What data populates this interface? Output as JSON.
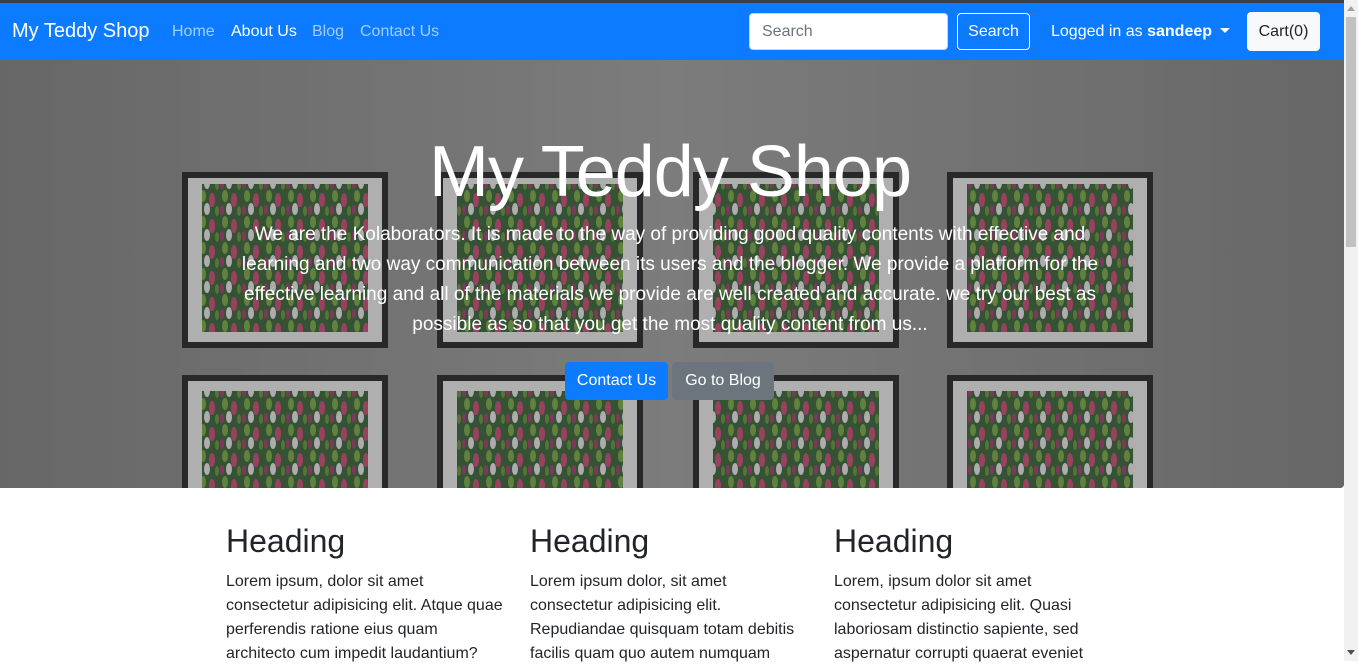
{
  "navbar": {
    "brand": "My Teddy Shop",
    "links": [
      {
        "label": "Home",
        "active": false
      },
      {
        "label": "About Us",
        "active": true
      },
      {
        "label": "Blog",
        "active": false
      },
      {
        "label": "Contact Us",
        "active": false
      }
    ],
    "search_placeholder": "Search",
    "search_button": "Search",
    "user_prefix": "Logged in as",
    "username": "sandeep",
    "cart_label": "Cart(0)"
  },
  "hero": {
    "title": "My Teddy Shop",
    "text": "We are the Kolaborators. It is made to the way of providing good quality contents with effective and learning and two way communication between its users and the blogger. We provide a platform for the effective learning and all of the materials we provide are well created and accurate. we try our best as possible as so that you get the most quality content from us...",
    "primary_button": "Contact Us",
    "secondary_button": "Go to Blog"
  },
  "columns": [
    {
      "heading": "Heading",
      "text": "Lorem ipsum, dolor sit amet consectetur adipisicing elit. Atque quae perferendis ratione eius quam architecto cum impedit laudantium?"
    },
    {
      "heading": "Heading",
      "text": "Lorem ipsum dolor, sit amet consectetur adipisicing elit. Repudiandae quisquam totam debitis facilis quam quo autem numquam"
    },
    {
      "heading": "Heading",
      "text": "Lorem, ipsum dolor sit amet consectetur adipisicing elit. Quasi laboriosam distinctio sapiente, sed aspernatur corrupti quaerat eveniet"
    }
  ],
  "colors": {
    "primary": "#0d7bff",
    "secondary": "#6c757d"
  }
}
